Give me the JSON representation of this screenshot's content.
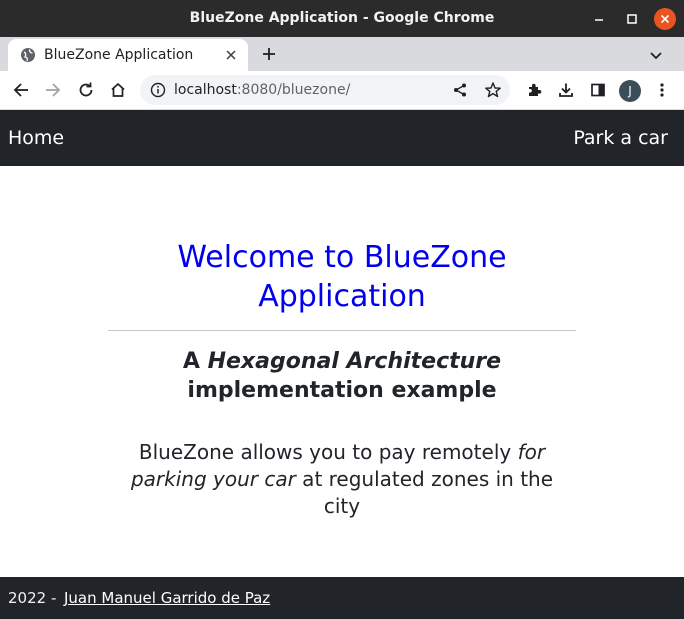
{
  "window": {
    "title": "BlueZone Application - Google Chrome",
    "close_color": "#e95420"
  },
  "tabs": [
    {
      "label": "BlueZone Application",
      "icon": "globe-icon",
      "active": true
    }
  ],
  "toolbar": {
    "url_host": "localhost",
    "url_rest": ":8080/bluezone/",
    "profile_initial": "J"
  },
  "navbar": {
    "home_label": "Home",
    "park_label": "Park a car",
    "background": "#212529"
  },
  "main": {
    "heading": "Welcome to BlueZone Application",
    "heading_color": "#0000ee",
    "subtitle_prefix": "A ",
    "subtitle_emphasis": "Hexagonal Architecture",
    "subtitle_suffix": " implementation example",
    "desc_prefix": "BlueZone allows you to pay remotely ",
    "desc_emphasis": "for parking your car",
    "desc_suffix": " at regulated zones in the city"
  },
  "footer": {
    "year_text": "2022 -",
    "author_link": "Juan Manuel Garrido de Paz"
  }
}
